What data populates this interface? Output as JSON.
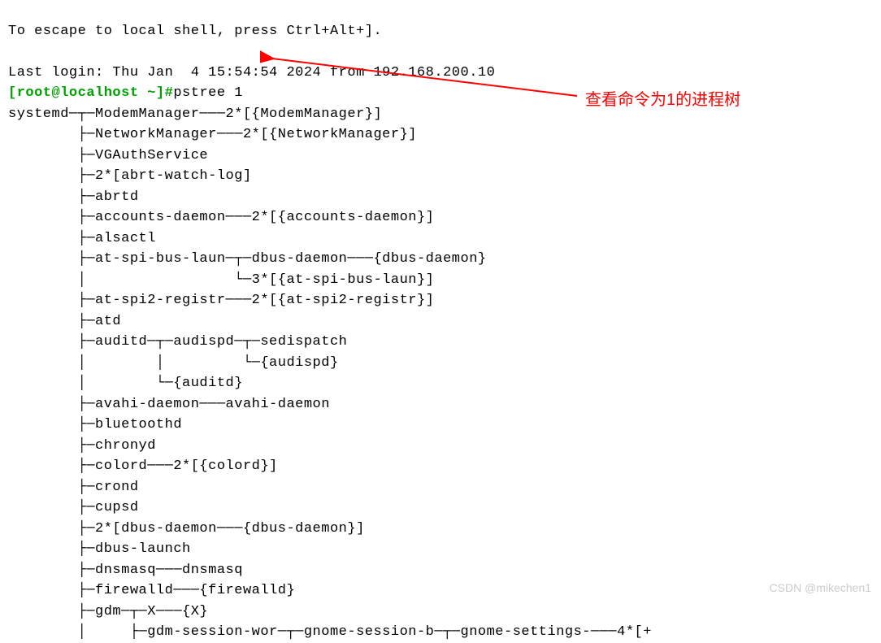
{
  "terminal": {
    "line0": "To escape to local shell, press Ctrl+Alt+].",
    "line_blank": "",
    "last_login": "Last login: Thu Jan  4 15:54:54 2024 from 192.168.200.10",
    "prompt": "[root@localhost ~]#",
    "command": "pstree 1",
    "tree": [
      "systemd─┬─ModemManager───2*[{ModemManager}]",
      "        ├─NetworkManager───2*[{NetworkManager}]",
      "        ├─VGAuthService",
      "        ├─2*[abrt-watch-log]",
      "        ├─abrtd",
      "        ├─accounts-daemon───2*[{accounts-daemon}]",
      "        ├─alsactl",
      "        ├─at-spi-bus-laun─┬─dbus-daemon───{dbus-daemon}",
      "        │                 └─3*[{at-spi-bus-laun}]",
      "        ├─at-spi2-registr───2*[{at-spi2-registr}]",
      "        ├─atd",
      "        ├─auditd─┬─audispd─┬─sedispatch",
      "        │        │         └─{audispd}",
      "        │        └─{auditd}",
      "        ├─avahi-daemon───avahi-daemon",
      "        ├─bluetoothd",
      "        ├─chronyd",
      "        ├─colord───2*[{colord}]",
      "        ├─crond",
      "        ├─cupsd",
      "        ├─2*[dbus-daemon───{dbus-daemon}]",
      "        ├─dbus-launch",
      "        ├─dnsmasq───dnsmasq",
      "        ├─firewalld───{firewalld}",
      "        ├─gdm─┬─X───{X}",
      "        │     ├─gdm-session-wor─┬─gnome-session-b─┬─gnome-settings-───4*[+"
    ]
  },
  "annotation": {
    "text": "查看命令为1的进程树"
  },
  "watermark": {
    "text": "CSDN @mikechen1"
  }
}
